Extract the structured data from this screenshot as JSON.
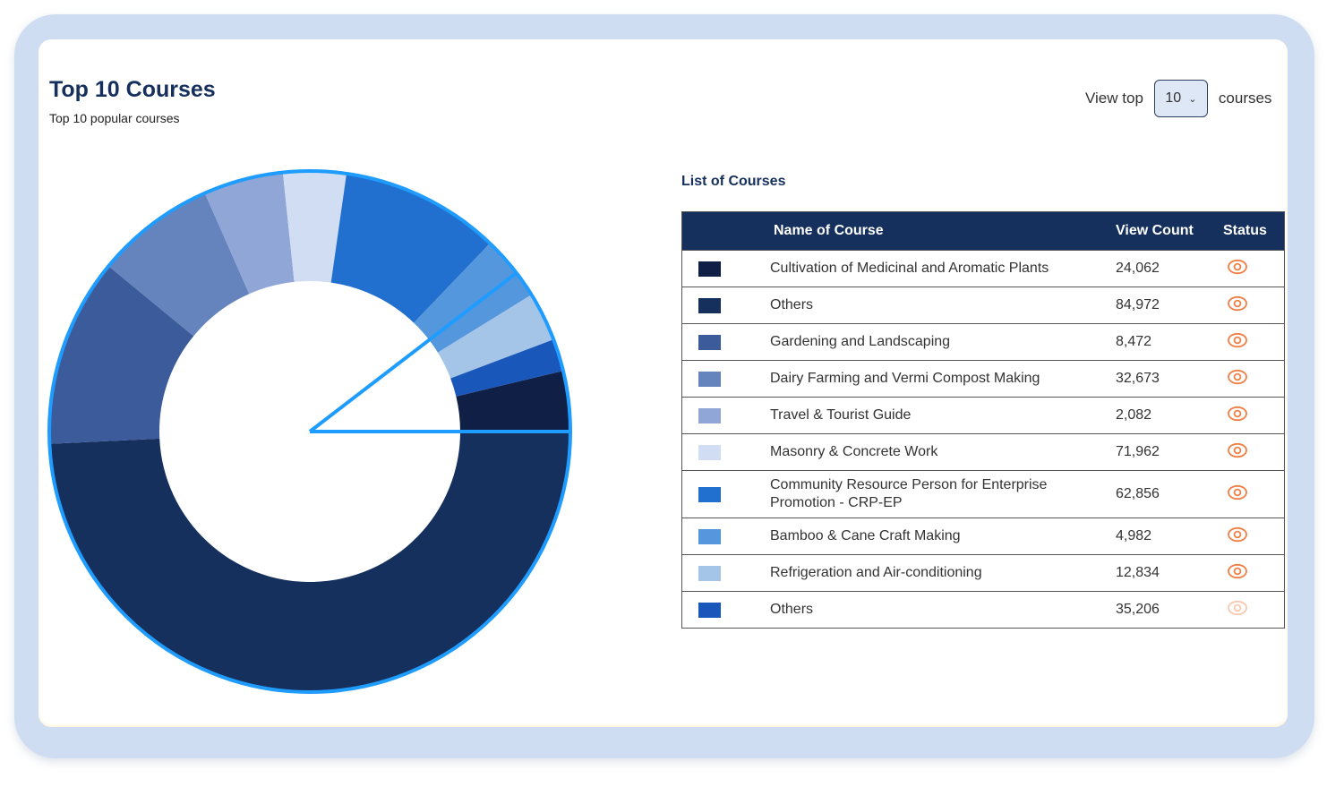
{
  "header": {
    "title": "Top 10 Courses",
    "subtitle": "Top 10 popular courses",
    "view_prefix": "View top",
    "view_value": "10",
    "view_suffix": "courses"
  },
  "list_title": "List of Courses",
  "table": {
    "columns": [
      "Name of Course",
      "View Count",
      "Status"
    ]
  },
  "colors": {
    "status_icon": "#f07f44",
    "status_icon_faded": "#f7c9b0",
    "highlight_stroke": "#1e9cff"
  },
  "chart_data": {
    "type": "donut",
    "total_label": "",
    "highlighted_index": 6,
    "categories": [
      "Cultivation of Medicinal and Aromatic Plants",
      "Others",
      "Gardening and Landscaping",
      "Dairy Farming and Vermi Compost Making",
      "Travel & Tourist Guide",
      "Masonry & Concrete Work",
      "Community Resource Person for Enterprise Promotion - CRP-EP",
      "Bamboo & Cane Craft Making",
      "Refrigeration and Air-conditioning",
      "Others"
    ],
    "counts": [
      "24,062",
      "84,972",
      "8,472",
      "32,673",
      "2,082",
      "71,962",
      "62,856",
      "4,982",
      "12,834",
      "35,206"
    ],
    "colors": [
      "#0f1f45",
      "#16305e",
      "#3b5b9a",
      "#6584be",
      "#8fa6d6",
      "#d0ddf3",
      "#2170cf",
      "#5597dc",
      "#a4c4e8",
      "#1a57bb"
    ],
    "status_faded": [
      false,
      false,
      false,
      false,
      false,
      false,
      false,
      false,
      false,
      true
    ],
    "slices": [
      {
        "name": "Cultivation of Medicinal and Aromatic Plants",
        "fraction": 0.0375,
        "color": "#0f1f45"
      },
      {
        "name": "Others",
        "fraction": 0.4925,
        "color": "#16305e"
      },
      {
        "name": "Gardening and Landscaping",
        "fraction": 0.117,
        "color": "#3b5b9a"
      },
      {
        "name": "Dairy Farming and Vermi Compost Making",
        "fraction": 0.0745,
        "color": "#6584be"
      },
      {
        "name": "Travel & Tourist Guide",
        "fraction": 0.0495,
        "color": "#8fa6d6"
      },
      {
        "name": "Masonry & Concrete Work",
        "fraction": 0.039,
        "color": "#d0ddf3"
      },
      {
        "name": "Community Resource Person for Enterprise Promotion - CRP-EP",
        "fraction": 0.099,
        "color": "#2170cf"
      },
      {
        "name": "Bamboo & Cane Craft Making",
        "fraction": 0.0405,
        "color": "#5597dc"
      },
      {
        "name": "Refrigeration and Air-conditioning",
        "fraction": 0.0305,
        "color": "#a4c4e8"
      },
      {
        "name": "Others",
        "fraction": 0.02,
        "color": "#1a57bb"
      }
    ]
  }
}
